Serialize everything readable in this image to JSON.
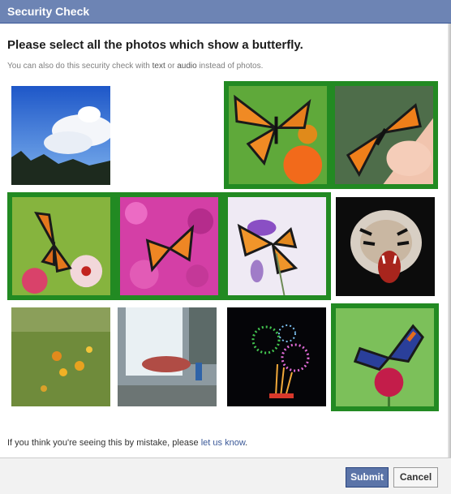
{
  "dialog": {
    "title": "Security Check",
    "heading": "Please select all the photos which show a butterfly.",
    "subtext_before": "You can also do this security check with ",
    "subtext_text_link": "text",
    "subtext_middle": " or ",
    "subtext_audio_link": "audio",
    "subtext_after": " instead of photos.",
    "footer_prefix": "If you think you're seeing this by mistake, please ",
    "footer_link": "let us know",
    "footer_suffix": ".",
    "submit_label": "Submit",
    "cancel_label": "Cancel"
  },
  "photos": [
    {
      "subject": "sky-clouds",
      "selected": false
    },
    {
      "subject": "empty",
      "selected": false
    },
    {
      "subject": "butterfly-on-flower",
      "selected": true
    },
    {
      "subject": "butterfly-on-hand",
      "selected": true
    },
    {
      "subject": "butterfly-on-flowers",
      "selected": true
    },
    {
      "subject": "butterfly-on-pink-flowers",
      "selected": true
    },
    {
      "subject": "butterfly-on-purple-flower",
      "selected": true
    },
    {
      "subject": "tiger",
      "selected": false
    },
    {
      "subject": "wildflowers",
      "selected": false
    },
    {
      "subject": "waterfall",
      "selected": false
    },
    {
      "subject": "fireworks",
      "selected": false
    },
    {
      "subject": "butterfly-on-red-flower",
      "selected": true
    }
  ],
  "colors": {
    "titlebar": "#6d84b4",
    "selection_border": "#228a22",
    "link": "#3b5998",
    "submit": "#5b74a8"
  }
}
